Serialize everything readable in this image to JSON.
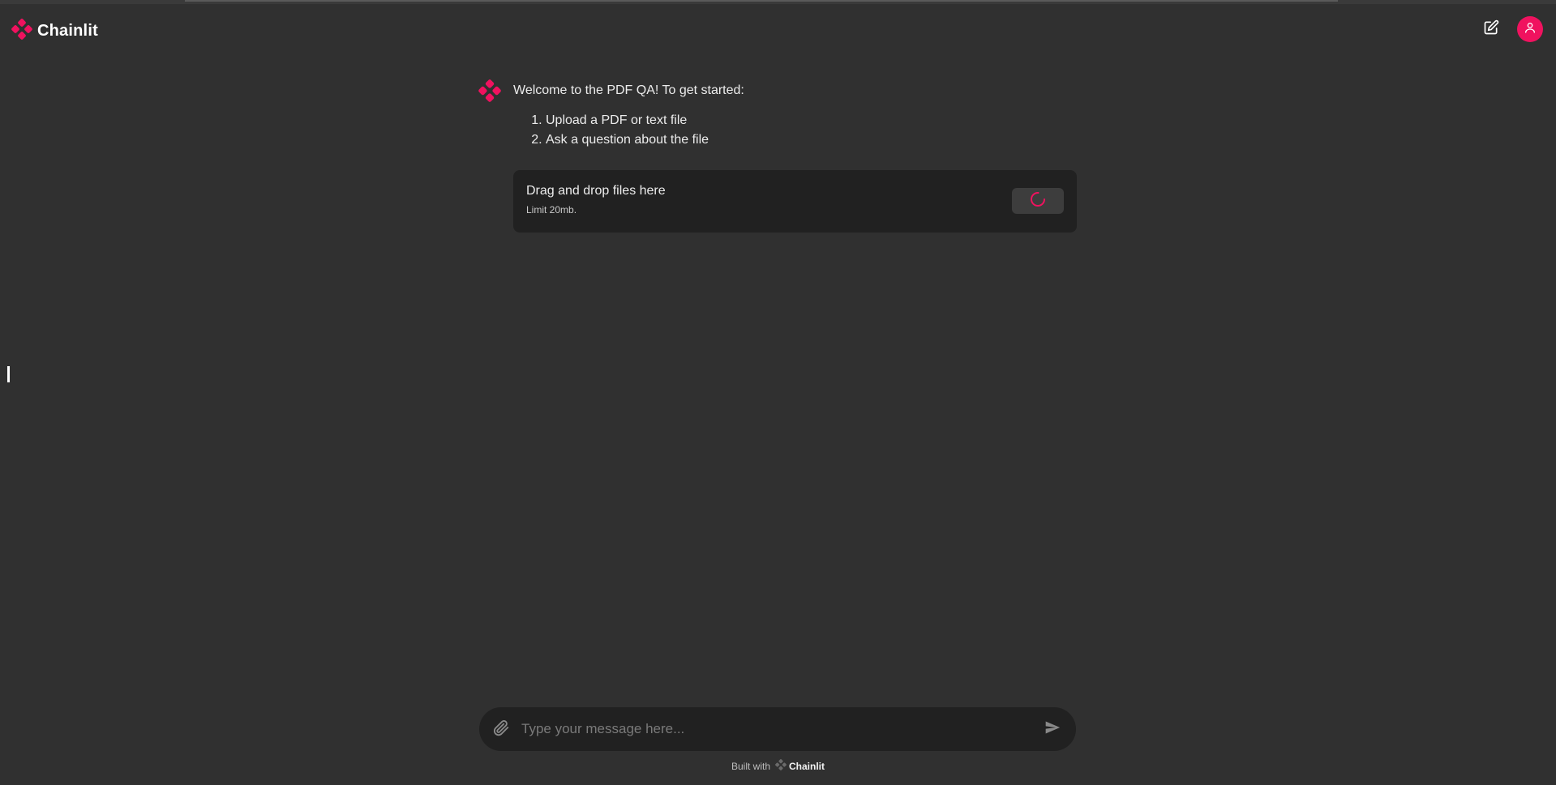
{
  "app": {
    "name": "Chainlit",
    "accent_color": "#f0125f"
  },
  "header": {
    "new_chat_icon": "pencil-square-icon",
    "user_icon": "user-icon"
  },
  "message": {
    "intro": "Welcome to the PDF QA! To get started:",
    "steps": [
      "Upload a PDF or text file",
      "Ask a question about the file"
    ],
    "upload": {
      "title": "Drag and drop files here",
      "limit": "Limit 20mb.",
      "button_state": "loading"
    }
  },
  "composer": {
    "placeholder": "Type your message here...",
    "attach_icon": "paperclip-icon",
    "send_icon": "send-icon"
  },
  "footer": {
    "built_with": "Built with",
    "brand": "Chainlit"
  }
}
